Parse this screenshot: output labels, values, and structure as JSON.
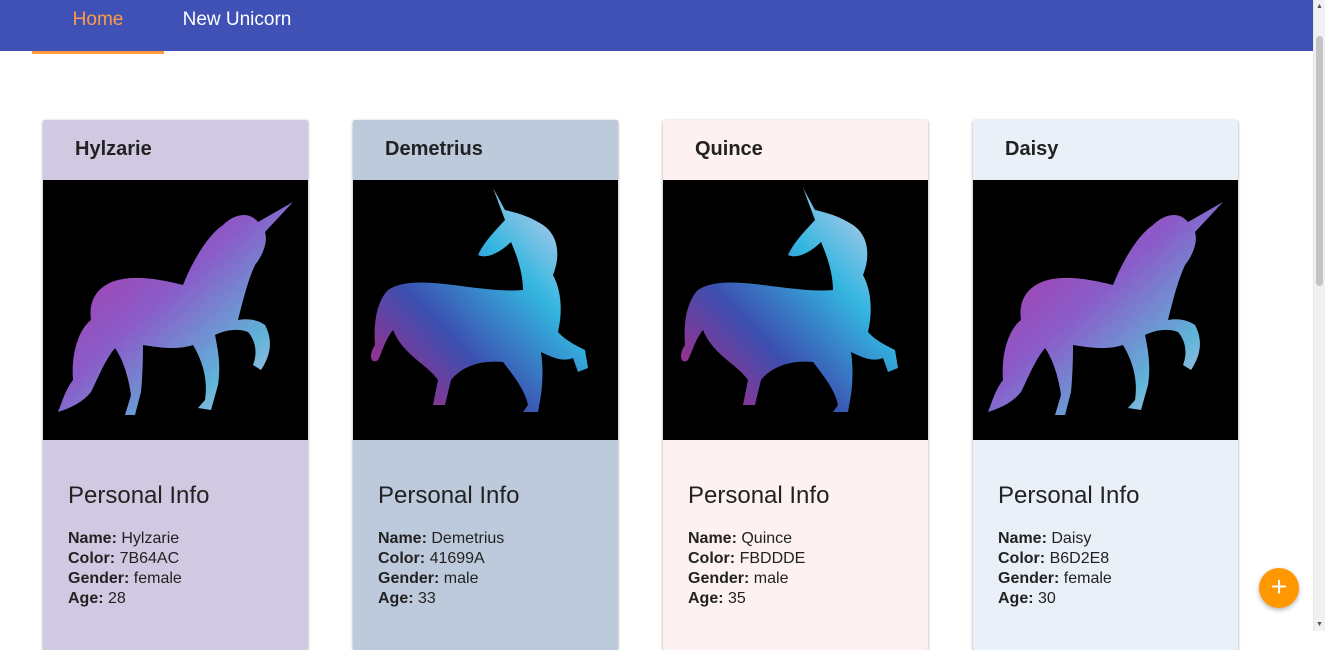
{
  "nav": {
    "tabs": [
      {
        "label": "Home",
        "active": true
      },
      {
        "label": "New Unicorn",
        "active": false
      }
    ]
  },
  "labels": {
    "info_heading": "Personal Info",
    "name": "Name:",
    "color": "Color:",
    "gender": "Gender:",
    "age": "Age:"
  },
  "unicorns": [
    {
      "title": "Hylzarie",
      "name": "Hylzarie",
      "color": "7B64AC",
      "gender": "female",
      "age": "28",
      "bg": "#d1c9e1",
      "image": "galaxy-unicorn-prancing"
    },
    {
      "title": "Demetrius",
      "name": "Demetrius",
      "color": "41699A",
      "gender": "male",
      "age": "33",
      "bg": "#bdcadc",
      "image": "galaxy-unicorn-standing"
    },
    {
      "title": "Quince",
      "name": "Quince",
      "color": "FBDDDE",
      "gender": "male",
      "age": "35",
      "bg": "#fdf1f1",
      "image": "galaxy-unicorn-standing"
    },
    {
      "title": "Daisy",
      "name": "Daisy",
      "color": "B6D2E8",
      "gender": "female",
      "age": "30",
      "bg": "#e9f0f8",
      "image": "galaxy-unicorn-prancing"
    }
  ],
  "colors": {
    "appbar": "#3f51b5",
    "active_tab": "#ff9a45",
    "fab": "#ff9800"
  },
  "fab": {
    "icon": "plus-icon",
    "glyph": "+"
  }
}
